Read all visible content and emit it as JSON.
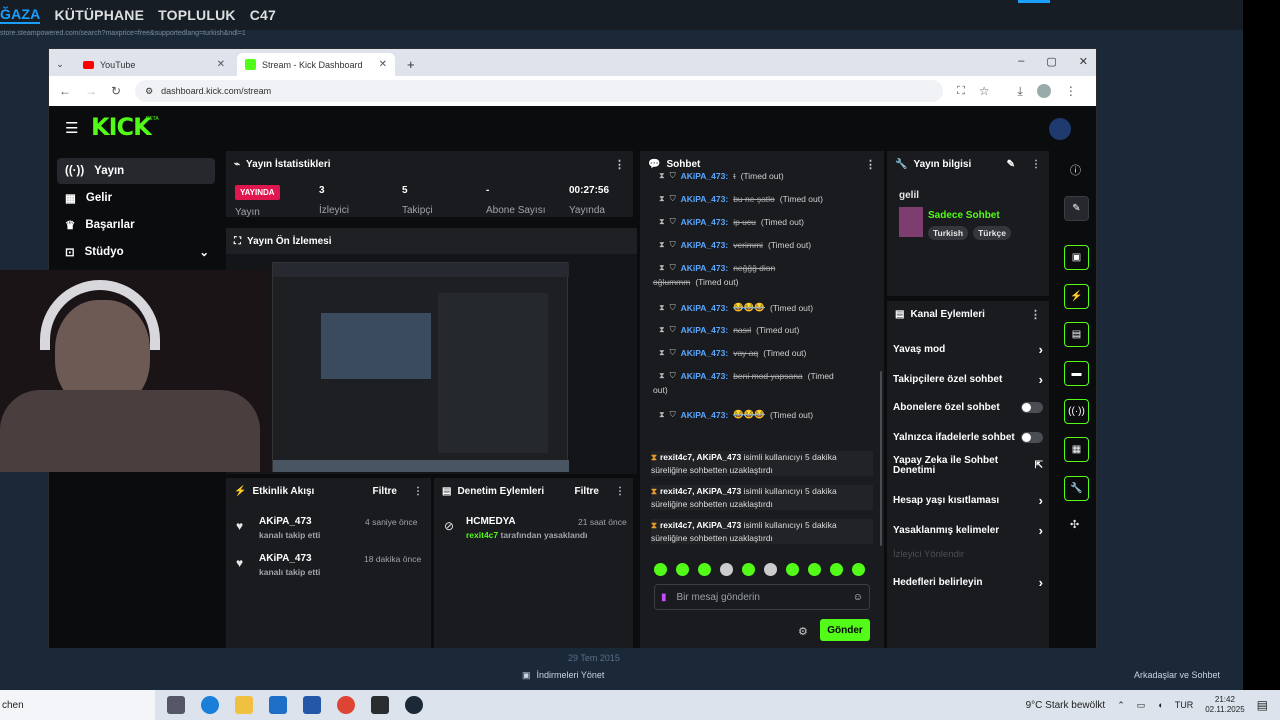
{
  "steam": {
    "nav": [
      "ĞAZA",
      "KÜTÜPHANE",
      "TOPLULUK",
      "C47"
    ],
    "url": "store.steampowered.com/search?maxprice=free&supportedlang=turkish&ndl=1",
    "bottom_left": "29 Tem 2015",
    "downloads": "İndirmeleri Yönet",
    "friends": "Arkadaşlar ve Sohbet"
  },
  "browser": {
    "tabs": [
      {
        "label": "YouTube"
      },
      {
        "label": "Stream - Kick Dashboard"
      }
    ],
    "url": "dashboard.kick.com/stream"
  },
  "kick": {
    "logo": "KICK",
    "logo_badge": "BETA",
    "sidebar": [
      {
        "label": "Yayın",
        "icon": "broadcast-icon"
      },
      {
        "label": "Gelir",
        "icon": "revenue-icon"
      },
      {
        "label": "Başarılar",
        "icon": "trophy-icon"
      },
      {
        "label": "Stüdyo",
        "icon": "studio-icon"
      }
    ],
    "stats": {
      "title": "Yayın İstatistikleri",
      "live_badge": "YAYINDA",
      "live_label": "Yayın",
      "items": [
        {
          "value": "3",
          "label": "İzleyici"
        },
        {
          "value": "5",
          "label": "Takipçi"
        },
        {
          "value": "-",
          "label": "Abone Sayısı"
        },
        {
          "value": "00:27:56",
          "label": "Yayında"
        }
      ]
    },
    "preview": {
      "title": "Yayın Ön İzlemesi"
    },
    "events": {
      "title": "Etkinlik Akışı",
      "filter": "Filtre",
      "items": [
        {
          "name": "AKiPA_473",
          "sub": "kanalı takip etti",
          "time": "4 saniye önce"
        },
        {
          "name": "AKiPA_473",
          "sub": "kanalı takip etti",
          "time": "18 dakika önce"
        }
      ]
    },
    "moderation": {
      "title": "Denetim Eylemleri",
      "filter": "Filtre",
      "items": [
        {
          "name": "HCMEDYA",
          "user": "rexit4c7",
          "sub": "tarafından yasaklandı",
          "time": "21 saat önce"
        }
      ]
    },
    "chat": {
      "title": "Sohbet",
      "messages": [
        {
          "user": "AKiPA_473",
          "text": "t",
          "note": "(Timed out)"
        },
        {
          "user": "AKiPA_473",
          "text": "bu ne şatlo",
          "note": "(Timed out)"
        },
        {
          "user": "AKiPA_473",
          "text": "ip ucu",
          "note": "(Timed out)"
        },
        {
          "user": "AKiPA_473",
          "text": "verimmi",
          "note": "(Timed out)"
        },
        {
          "user": "AKiPA_473",
          "text": "neğğğ dion",
          "note": ""
        },
        {
          "user": "",
          "text": "oğlummm",
          "note": "(Timed out)"
        },
        {
          "user": "AKiPA_473",
          "text": "😂😂😂",
          "note": "(Timed out)"
        },
        {
          "user": "AKiPA_473",
          "text": "nasıl",
          "note": "(Timed out)"
        },
        {
          "user": "AKiPA_473",
          "text": "vay aq",
          "note": "(Timed out)"
        },
        {
          "user": "AKiPA_473",
          "text": "beni mod yapsana",
          "note": "(Timed"
        },
        {
          "user": "",
          "text": "",
          "note": "out)"
        },
        {
          "user": "AKiPA_473",
          "text": "😂😂😂",
          "note": "(Timed out)"
        }
      ],
      "mod_actions": [
        {
          "actor": "rexit4c7, AKiPA_473",
          "text": "isimli kullanıcıyı 5 dakika süreliğine sohbetten uzaklaştırdı"
        },
        {
          "actor": "rexit4c7, AKiPA_473",
          "text": "isimli kullanıcıyı 5 dakika süreliğine sohbetten uzaklaştırdı"
        },
        {
          "actor": "rexit4c7, AKiPA_473",
          "text": "isimli kullanıcıyı 5 dakika süreliğine sohbetten uzaklaştırdı"
        }
      ],
      "input_placeholder": "Bir mesaj gönderin",
      "send": "Gönder"
    },
    "stream_info": {
      "title": "Yayın bilgisi",
      "stream_title": "gelil",
      "category": "Sadece Sohbet",
      "tags": [
        "Turkish",
        "Türkçe"
      ]
    },
    "channel_actions": {
      "title": "Kanal Eylemleri",
      "items": [
        {
          "label": "Yavaş mod",
          "type": "chevron"
        },
        {
          "label": "Takipçilere özel sohbet",
          "type": "chevron"
        },
        {
          "label": "Abonelere özel sohbet",
          "type": "toggle"
        },
        {
          "label": "Yalnızca ifadelerle sohbet",
          "type": "toggle"
        },
        {
          "label": "Yapay Zeka ile Sohbet Denetimi",
          "type": "external"
        },
        {
          "label": "Hesap yaşı kısıtlaması",
          "type": "chevron"
        },
        {
          "label": "Yasaklanmış kelimeler",
          "type": "chevron"
        }
      ],
      "dimmed": "İzleyici Yönlendir",
      "goals": "Hedefleri belirleyin"
    }
  },
  "taskbar": {
    "search": "chen",
    "weather": "9°C  Stark bewölkt",
    "lang": "TUR",
    "time": "21:42",
    "date": "02.11.2025"
  },
  "colors": {
    "kick_green": "#53fc18",
    "live_red": "#e0164f"
  }
}
